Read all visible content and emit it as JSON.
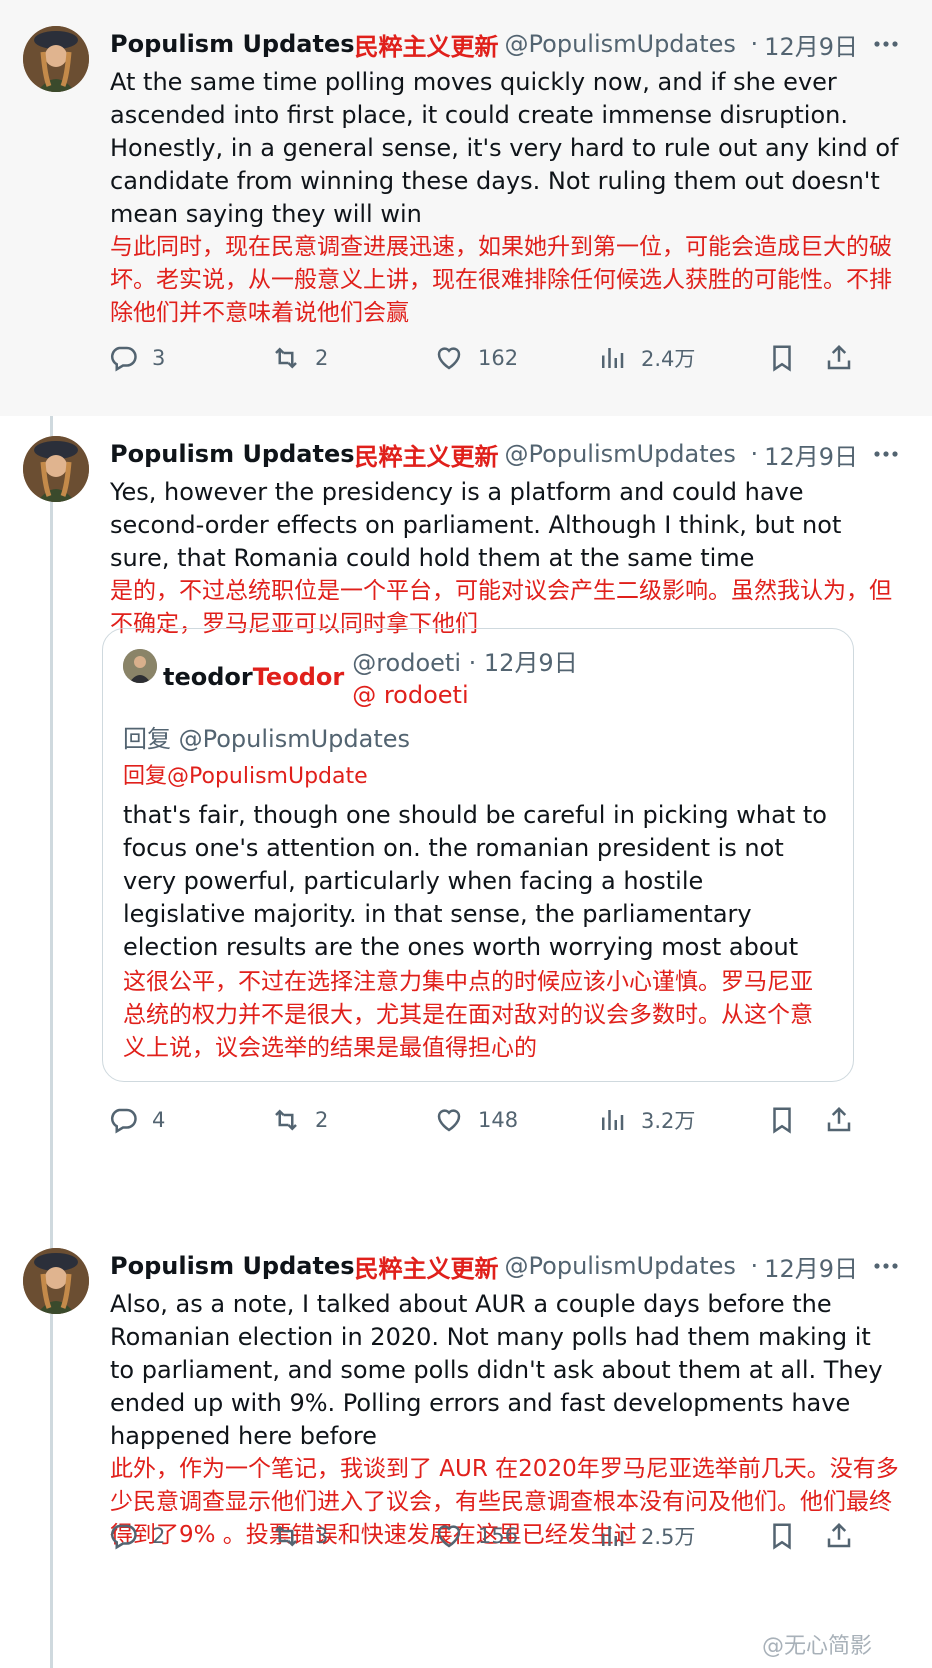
{
  "author": {
    "name": "Populism Updates",
    "name_cn": "民粹主义更新",
    "handle": "@PopulismUpdates"
  },
  "tweets": [
    {
      "date": "12月9日",
      "text_en": "At the same time polling moves quickly now, and if she ever ascended into first place, it could create immense disruption. Honestly, in a general sense, it's very hard to rule out any kind of candidate from winning these days. Not ruling them out doesn't mean saying they will win",
      "text_cn": "与此同时，现在民意调查进展迅速，如果她升到第一位，可能会造成巨大的破坏。老实说，从一般意义上讲，现在很难排除任何候选人获胜的可能性。不排除他们并不意味着说他们会赢",
      "replies": "3",
      "reposts": "2",
      "likes": "162",
      "views": "2.4万"
    },
    {
      "date": "12月9日",
      "text_en": "Yes, however the presidency is a platform and could have second-order effects on parliament. Although I think, but not sure, that Romania could hold them at the same time",
      "text_cn": "是的，不过总统职位是一个平台，可能对议会产生二级影响。虽然我认为，但不确定，罗马尼亚可以同时拿下他们",
      "replies": "4",
      "reposts": "2",
      "likes": "148",
      "views": "3.2万"
    },
    {
      "date": "12月9日",
      "text_en": "Also, as a note, I talked about AUR a couple days before the Romanian election in 2020. Not many polls had them making it to parliament, and some polls didn't ask about them at all. They ended up with 9%. Polling errors and fast developments have happened here before",
      "text_cn": "此外，作为一个笔记，我谈到了 AUR 在2020年罗马尼亚选举前几天。没有多少民意调查显示他们进入了议会，有些民意调查根本没有问及他们。他们最终得到了9% 。投票错误和快速发展在这里已经发生过",
      "replies": "2",
      "reposts": "3",
      "likes": "156",
      "views": "2.5万"
    }
  ],
  "quote": {
    "name": "teodor",
    "name_cn": "Teodor",
    "handle": "@rodoeti",
    "handle_cn": "@ rodoeti",
    "date": "· 12月9日",
    "reply_to": "回复 @PopulismUpdates",
    "reply_to_cn": "回复@PopulismUpdate",
    "text_en": "that's fair, though one should be careful in picking what to focus one's attention on. the romanian president is not very powerful, particularly when facing a hostile legislative majority. in that sense, the parliamentary election results are the ones worth worrying most about",
    "text_cn": "这很公平，不过在选择注意力集中点的时候应该小心谨慎。罗马尼亚总统的权力并不是很大，尤其是在面对敌对的议会多数时。从这个意义上说，议会选举的结果是最值得担心的"
  },
  "watermark": "@无心简影",
  "icons": [
    "more-icon",
    "reply-icon",
    "repost-icon",
    "like-icon",
    "views-icon",
    "bookmark-icon",
    "share-icon"
  ]
}
